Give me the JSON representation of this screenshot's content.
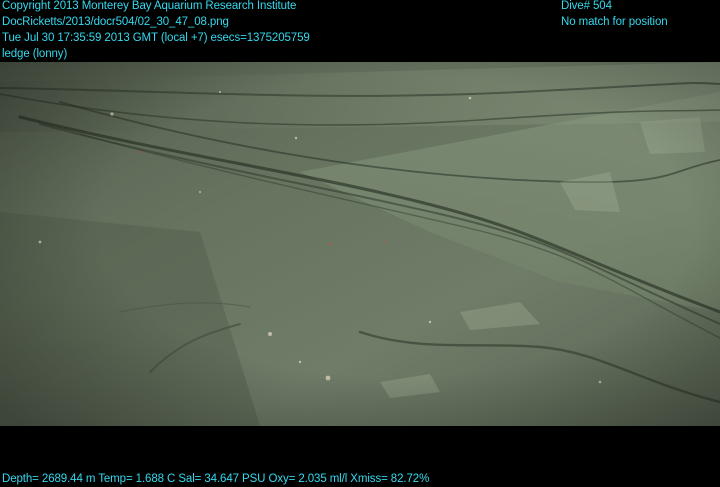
{
  "header": {
    "copyright": "Copyright 2013 Monterey Bay Aquarium Research Institute",
    "file_path": "DocRicketts/2013/docr504/02_30_47_08.png",
    "timestamp": "Tue Jul 30 17:35:59 2013 GMT (local +7)  esecs=1375205759",
    "annotation": "ledge (lonny)",
    "dive": "Dive# 504",
    "position_status": "No match for position"
  },
  "footer": {
    "sensor_readout": "Depth= 2689.44 m  Temp= 1.688 C  Sal= 34.647 PSU  Oxy= 2.035 ml/l  Xmiss= 82.72%"
  },
  "colors": {
    "overlay_text": "#33d9ee",
    "background": "#000000",
    "seafloor": "#6b7a63"
  }
}
